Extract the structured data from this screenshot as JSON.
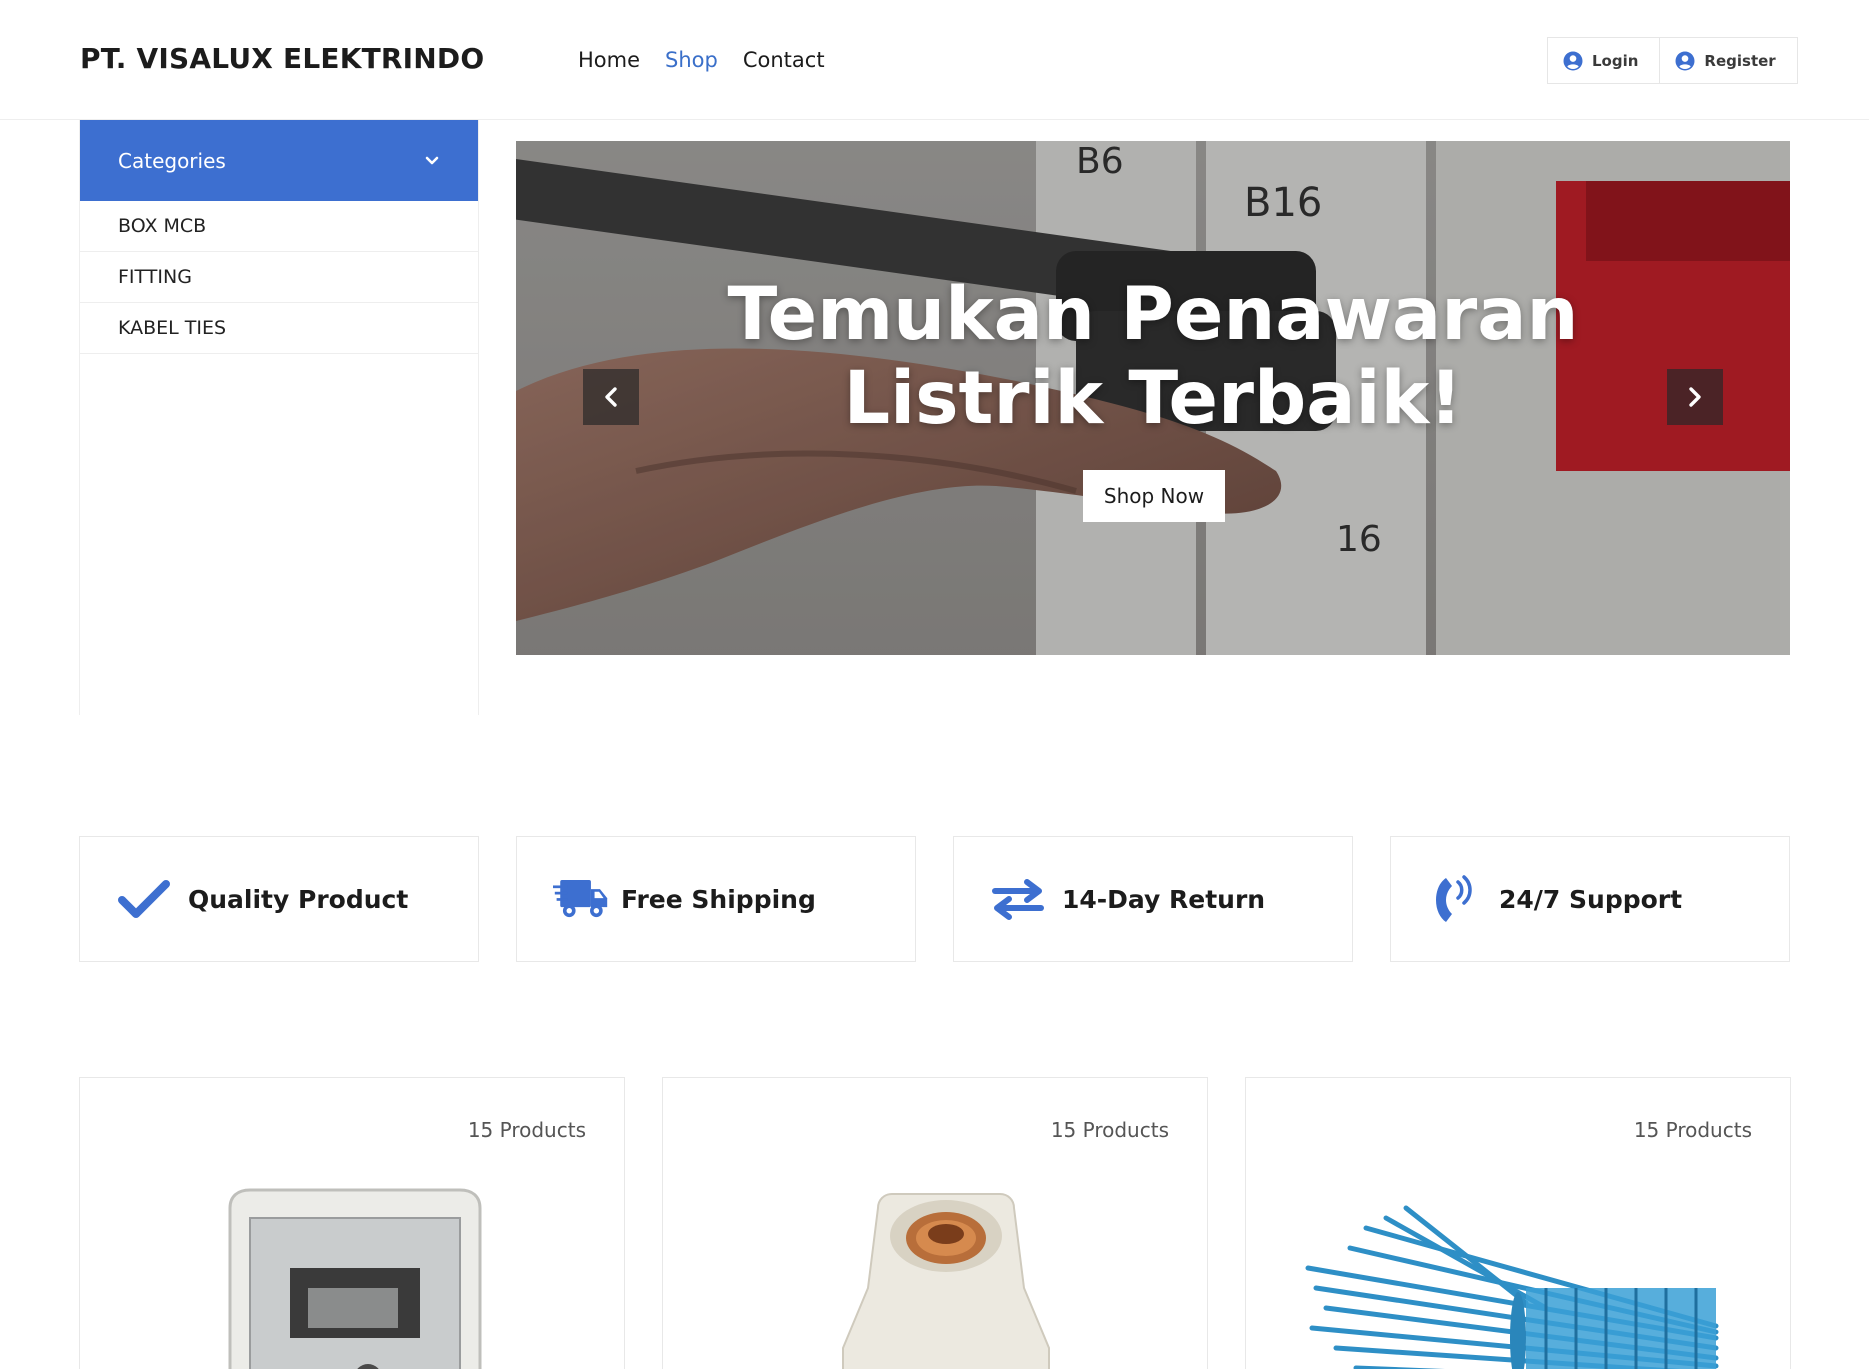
{
  "header": {
    "brand": "PT. VISALUX ELEKTRINDO",
    "nav": [
      {
        "label": "Home",
        "active": false
      },
      {
        "label": "Shop",
        "active": true
      },
      {
        "label": "Contact",
        "active": false
      }
    ],
    "auth": {
      "login": "Login",
      "register": "Register",
      "icon": "user-circle-icon"
    }
  },
  "sidebar": {
    "title": "Categories",
    "icon": "chevron-down-icon",
    "items": [
      {
        "label": "BOX MCB"
      },
      {
        "label": "FITTING"
      },
      {
        "label": "KABEL TIES"
      }
    ]
  },
  "hero": {
    "title_line1": "Temukan Penawaran",
    "title_line2": "Listrik Terbaik!",
    "button": "Shop Now",
    "prev_icon": "chevron-left-icon",
    "next_icon": "chevron-right-icon"
  },
  "features": [
    {
      "label": "Quality Product",
      "icon": "check-icon"
    },
    {
      "label": "Free Shipping",
      "icon": "shipping-truck-icon"
    },
    {
      "label": "14-Day Return",
      "icon": "exchange-arrows-icon"
    },
    {
      "label": "24/7 Support",
      "icon": "phone-volume-icon"
    }
  ],
  "categories_cards": [
    {
      "count": "15 Products",
      "image": "box-mcb-image"
    },
    {
      "count": "15 Products",
      "image": "fitting-image"
    },
    {
      "count": "15 Products",
      "image": "kabel-ties-image"
    }
  ],
  "colors": {
    "accent": "#3d6fd0",
    "link_active": "#3a6fc9",
    "text": "#1c1c1c",
    "border": "#eeeeee"
  }
}
